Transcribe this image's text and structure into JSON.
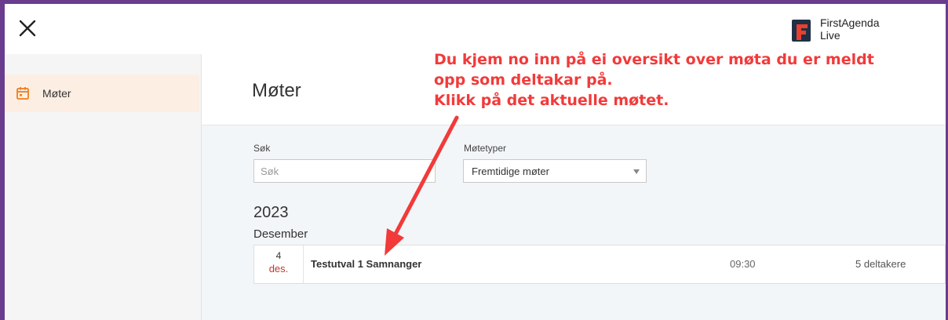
{
  "header": {
    "close_icon": "close-icon",
    "logo": {
      "line1": "FirstAgenda",
      "line2": "Live",
      "brand_color": "#e8402f",
      "icon": "firstagenda-logo-icon"
    }
  },
  "sidebar": {
    "items": [
      {
        "label": "Møter",
        "icon": "calendar-icon",
        "active": true
      }
    ],
    "accent_color": "#f07d1a"
  },
  "main": {
    "title": "Møter",
    "filters": {
      "search_label": "Søk",
      "search_placeholder": "Søk",
      "search_value": "",
      "type_label": "Møtetyper",
      "type_selected": "Fremtidige møter"
    },
    "groups": [
      {
        "year": "2023",
        "month": "Desember",
        "meetings": [
          {
            "day": "4",
            "month_short": "des.",
            "title": "Testutval 1 Samnanger",
            "time": "09:30",
            "participants": "5 deltakere"
          }
        ]
      }
    ]
  },
  "annotation": {
    "lines": [
      "Du kjem no inn på ei oversikt over møta du er meldt",
      "opp som deltakar på.",
      "Klikk på det aktuelle møtet."
    ],
    "color": "#f23a3a"
  }
}
